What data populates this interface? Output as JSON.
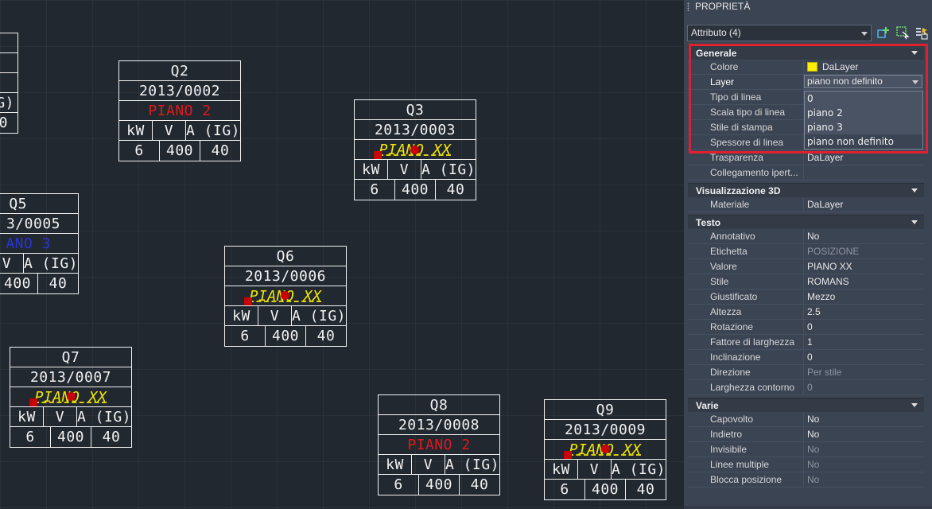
{
  "palette": {
    "title": "PROPRIETÀ",
    "selection": "Attributo (4)",
    "categories": {
      "generale": {
        "label": "Generale",
        "rows": [
          {
            "key": "Colore",
            "value": "DaLayer"
          },
          {
            "key": "Layer",
            "value": "piano non definito"
          },
          {
            "key": "Tipo di linea",
            "value": ""
          },
          {
            "key": "Scala tipo di linea",
            "value": ""
          },
          {
            "key": "Stile di stampa",
            "value": ""
          },
          {
            "key": "Spessore di linea",
            "value": ""
          },
          {
            "key": "Trasparenza",
            "value": "DaLayer"
          },
          {
            "key": "Collegamento ipert...",
            "value": ""
          }
        ]
      },
      "vis3d": {
        "label": "Visualizzazione 3D",
        "rows": [
          {
            "key": "Materiale",
            "value": "DaLayer"
          }
        ]
      },
      "testo": {
        "label": "Testo",
        "rows": [
          {
            "key": "Annotativo",
            "value": "No"
          },
          {
            "key": "Etichetta",
            "value": "POSIZIONE"
          },
          {
            "key": "Valore",
            "value": "PIANO XX"
          },
          {
            "key": "Stile",
            "value": "ROMANS"
          },
          {
            "key": "Giustificato",
            "value": "Mezzo"
          },
          {
            "key": "Altezza",
            "value": "2.5"
          },
          {
            "key": "Rotazione",
            "value": "0"
          },
          {
            "key": "Fattore di larghezza",
            "value": "1"
          },
          {
            "key": "Inclinazione",
            "value": "0"
          },
          {
            "key": "Direzione",
            "value": "Per stile"
          },
          {
            "key": "Larghezza contorno",
            "value": "0"
          }
        ]
      },
      "varie": {
        "label": "Varie",
        "rows": [
          {
            "key": "Capovolto",
            "value": "No"
          },
          {
            "key": "Indietro",
            "value": "No"
          },
          {
            "key": "Invisibile",
            "value": "No"
          },
          {
            "key": "Linee multiple",
            "value": "No"
          },
          {
            "key": "Blocca posizione",
            "value": "No"
          }
        ]
      }
    },
    "layer_dropdown": [
      "0",
      "piano 2",
      "piano 3",
      "piano non definito"
    ],
    "colors": {
      "highlight": "#e1202e",
      "swatch": "#ffee00"
    }
  },
  "blocks": [
    {
      "id": "Q2",
      "number": "2013/0002",
      "piano": "PIANO 2",
      "kw": "kW",
      "v": "V",
      "a": "A (IG)",
      "kw_val": "6",
      "v_val": "400",
      "a_val": "40"
    },
    {
      "id": "Q3",
      "number": "2013/0003",
      "piano": "PIANO XX",
      "kw": "kW",
      "v": "V",
      "a": "A (IG)",
      "kw_val": "6",
      "v_val": "400",
      "a_val": "40"
    },
    {
      "id": "Q5",
      "number": "3/0005",
      "piano": "ANO 3",
      "v": "V",
      "a": "A (IG)",
      "v_val": "400",
      "a_val": "40"
    },
    {
      "id": "Q6",
      "number": "2013/0006",
      "piano": "PIANO XX",
      "kw": "kW",
      "v": "V",
      "a": "A (IG)",
      "kw_val": "6",
      "v_val": "400",
      "a_val": "40"
    },
    {
      "id": "Q7",
      "number": "2013/0007",
      "piano": "PIANO XX",
      "kw": "kW",
      "v": "V",
      "a": "A (IG)",
      "kw_val": "6",
      "v_val": "400",
      "a_val": "40"
    },
    {
      "id": "Q8",
      "number": "2013/0008",
      "piano": "PIANO 2",
      "kw": "kW",
      "v": "V",
      "a": "A (IG)",
      "kw_val": "6",
      "v_val": "400",
      "a_val": "40"
    },
    {
      "id": "Q9",
      "number": "2013/0009",
      "piano": "PIANO XX",
      "kw": "kW",
      "v": "V",
      "a": "A (IG)",
      "kw_val": "6",
      "v_val": "400",
      "a_val": "40"
    }
  ],
  "partial_left": {
    "a": "IG)",
    "zero": "0"
  }
}
